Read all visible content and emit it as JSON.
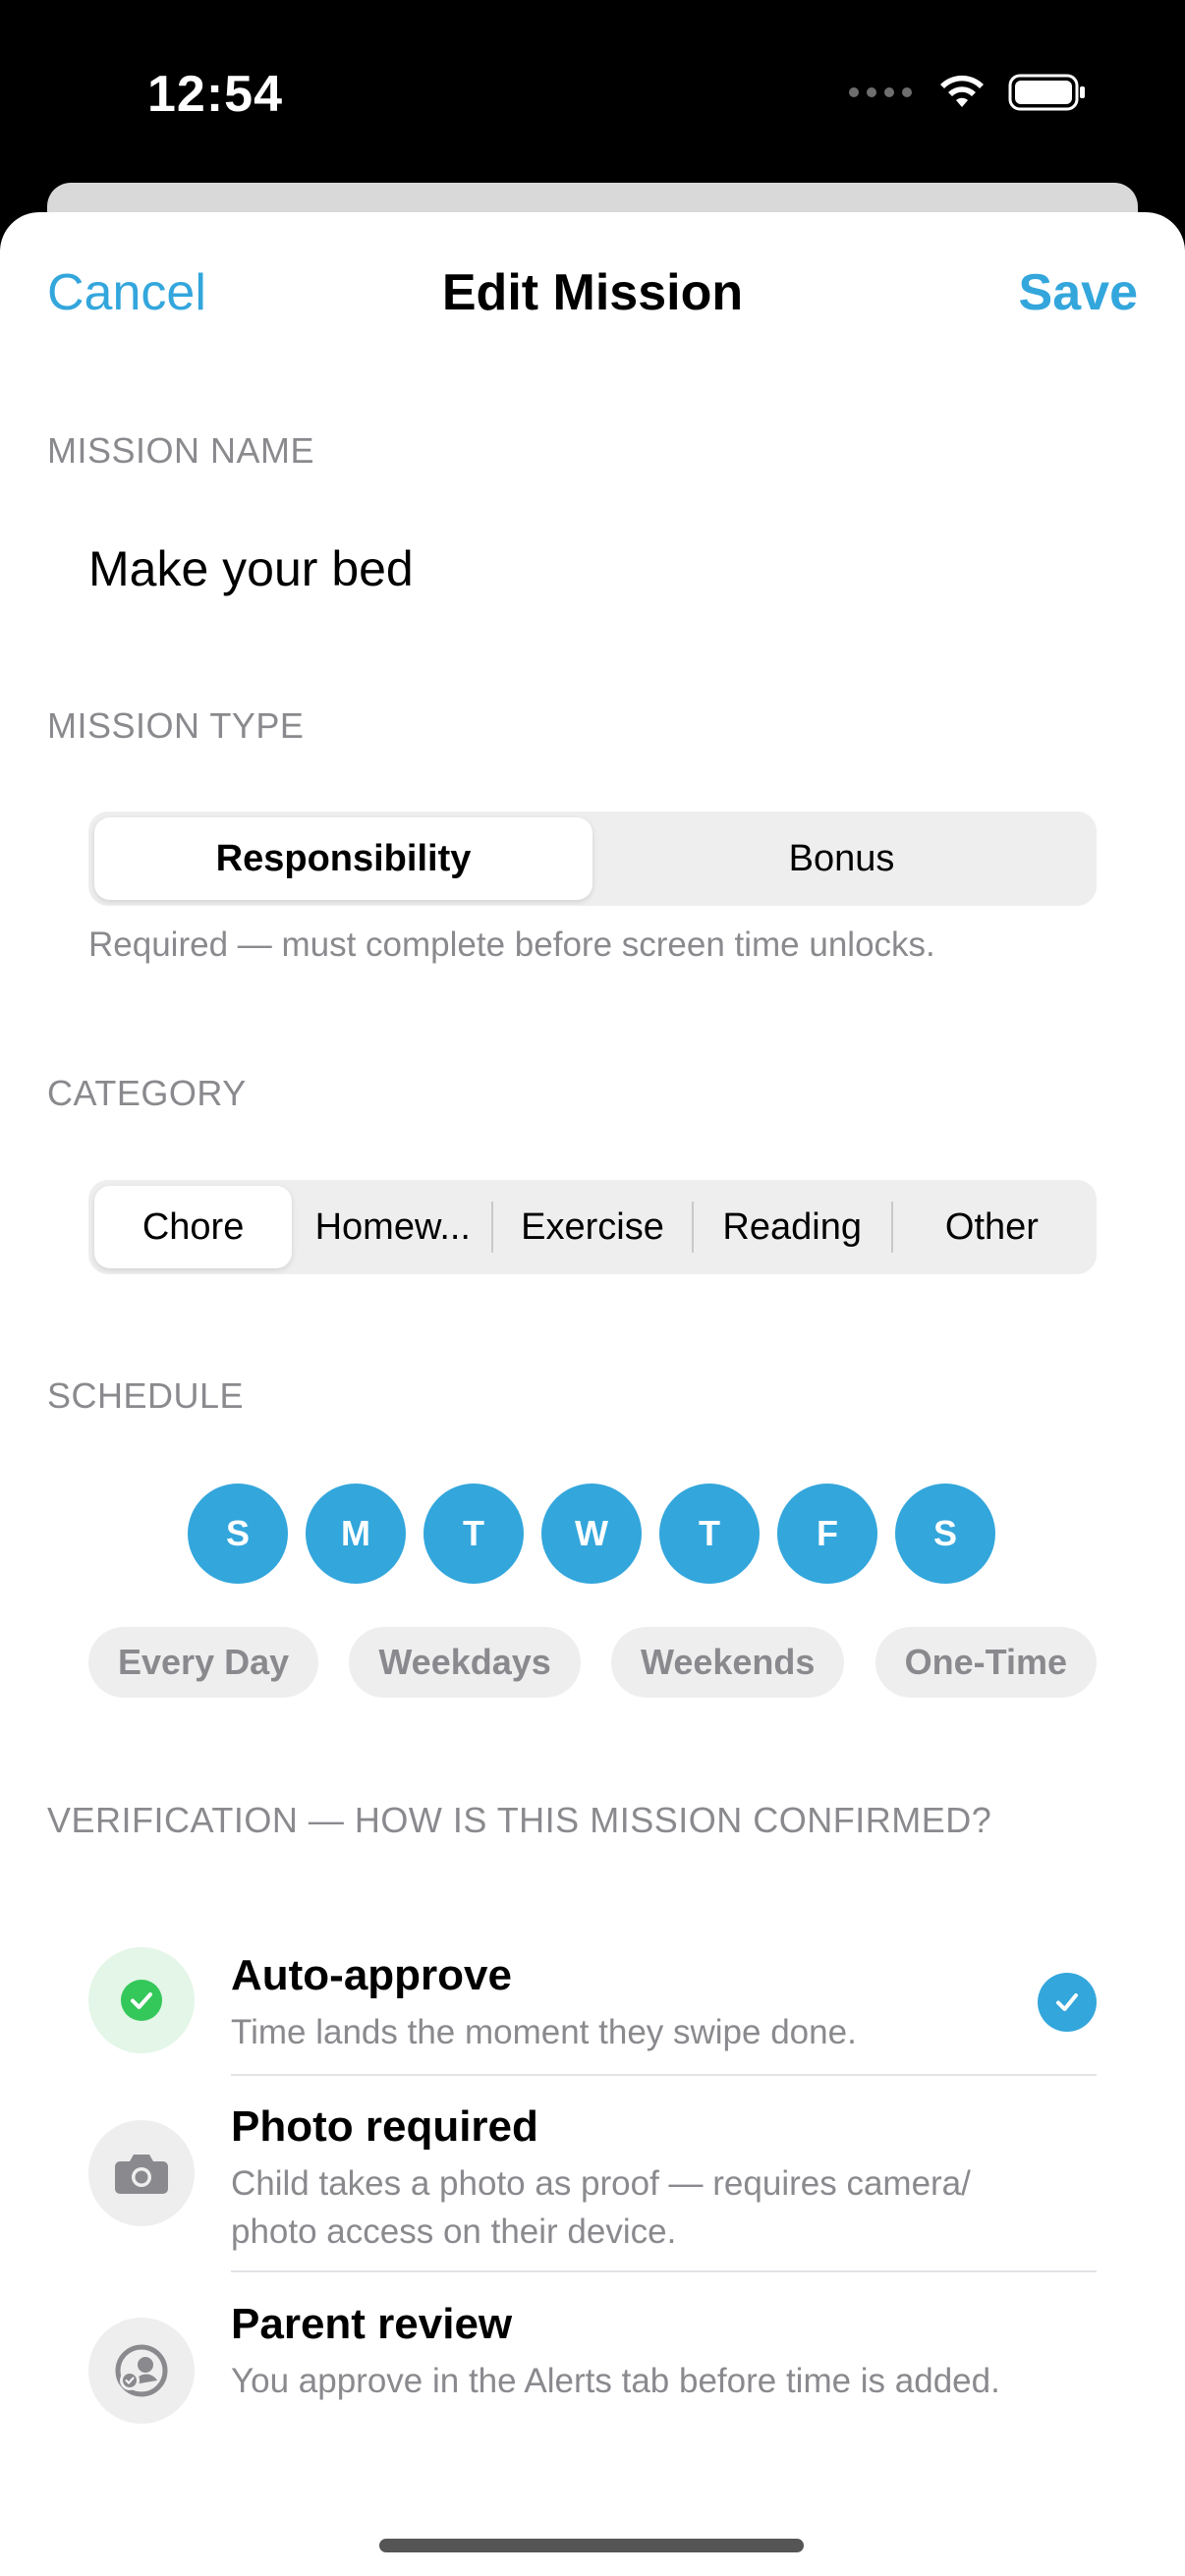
{
  "status_bar": {
    "time": "12:54"
  },
  "nav": {
    "cancel": "Cancel",
    "title": "Edit Mission",
    "save": "Save"
  },
  "mission_name": {
    "label": "MISSION NAME",
    "value": "Make your bed"
  },
  "mission_type": {
    "label": "MISSION TYPE",
    "options": [
      "Responsibility",
      "Bonus"
    ],
    "selected": "Responsibility",
    "hint": "Required — must complete before screen time unlocks."
  },
  "category": {
    "label": "CATEGORY",
    "options": [
      "Chore",
      "Homew...",
      "Exercise",
      "Reading",
      "Other"
    ],
    "selected": "Chore"
  },
  "schedule": {
    "label": "SCHEDULE",
    "days": [
      "S",
      "M",
      "T",
      "W",
      "T",
      "F",
      "S"
    ],
    "presets": [
      "Every Day",
      "Weekdays",
      "Weekends",
      "One-Time"
    ]
  },
  "verification": {
    "label": "VERIFICATION — HOW IS THIS MISSION CONFIRMED?",
    "options": [
      {
        "title": "Auto-approve",
        "description": "Time lands the moment they swipe done.",
        "icon": "checkmark-circle-icon",
        "selected": true
      },
      {
        "title": "Photo required",
        "description": "Child takes a photo as proof — requires camera/ photo access on their device.",
        "icon": "camera-icon",
        "selected": false
      },
      {
        "title": "Parent review",
        "description": "You approve in the Alerts tab before time is added.",
        "icon": "parent-review-icon",
        "selected": false
      }
    ]
  },
  "colors": {
    "accent": "#33a6dc",
    "success": "#34c759",
    "success_bg": "#e3f6e7",
    "muted": "#8a8a8e"
  }
}
